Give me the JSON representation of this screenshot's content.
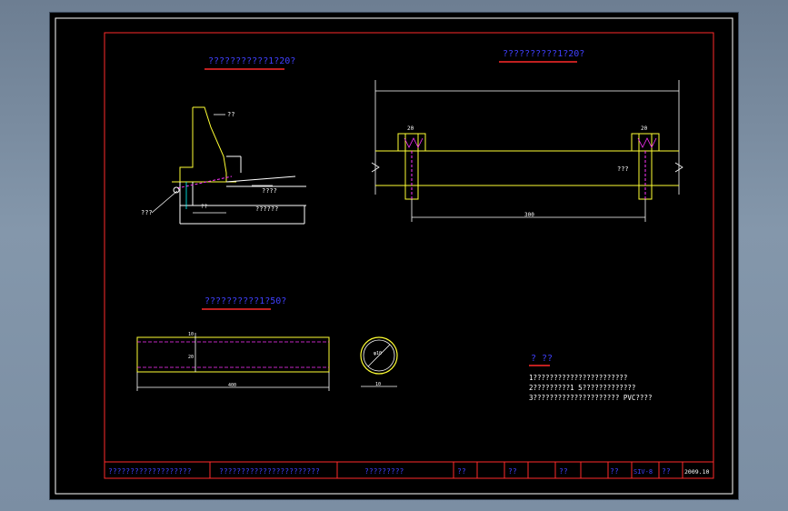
{
  "colors": {
    "background": "#000000",
    "border": "#ffffff",
    "frame": "#ff2a2a",
    "outline": "#ffff33",
    "dashed": "#ff33ff",
    "title_text": "#4040ff",
    "dims": "#ffffff",
    "cyan": "#00ffff"
  },
  "views": {
    "section_title": "???????????1?20?",
    "elevation_title": "??????????1?20?",
    "pipe_title": "??????????1?50?",
    "section_labels": {
      "top_note": "??",
      "dim_dy": "??",
      "pavement": "????",
      "subgrade": "??????",
      "pipe_tag": "???"
    },
    "elevation_labels": {
      "left_slot": "20",
      "right_slot": "20",
      "mid_note": "???",
      "span_dim": "300"
    },
    "pipe_labels": {
      "length_dim": "400",
      "top_dim": "10",
      "mid_dim": "20",
      "dia_dim": "φ10",
      "circle_dim": "10"
    }
  },
  "notes": {
    "heading": "? ??",
    "lines": [
      "1???????????????????????",
      "2?????????1 5?????????????",
      "3????????????????????? PVC????"
    ]
  },
  "title_block": {
    "cells": [
      "???????????????????",
      "???????????????????????",
      "?????????",
      "??",
      "??",
      "??",
      "??",
      "SIV-8",
      "??",
      "2009.10"
    ]
  }
}
